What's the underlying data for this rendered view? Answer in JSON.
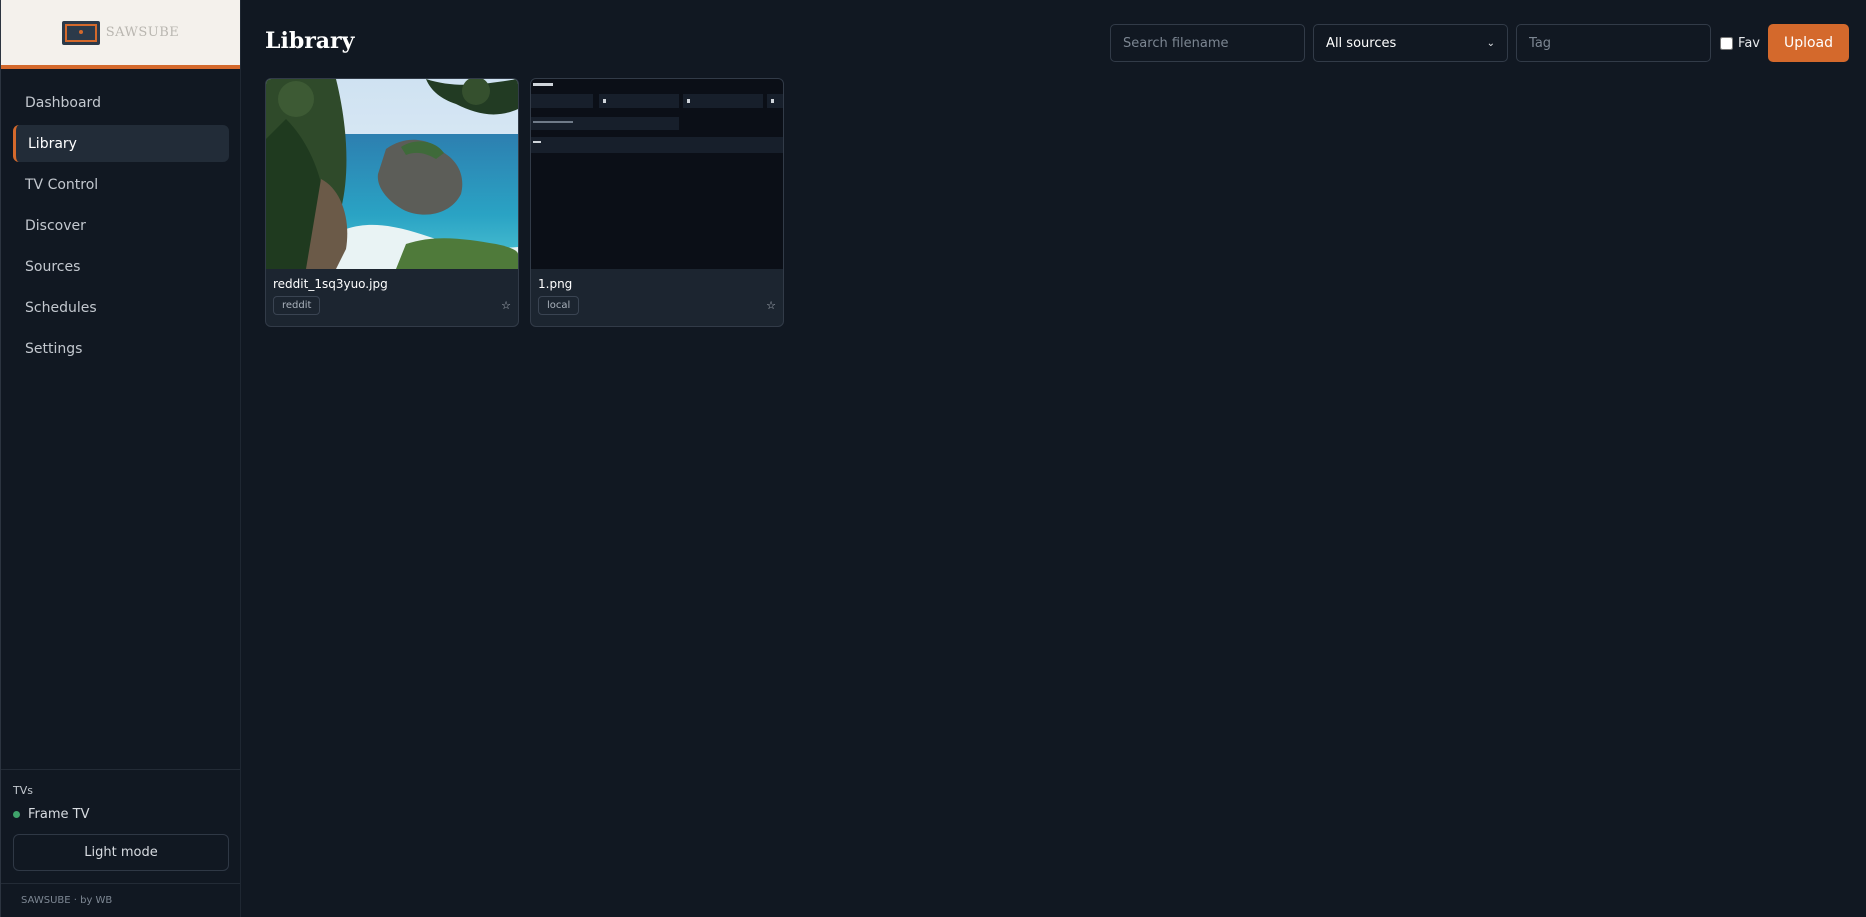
{
  "brand": {
    "name": "SAWSUBE"
  },
  "nav": {
    "items": [
      {
        "label": "Dashboard"
      },
      {
        "label": "Library"
      },
      {
        "label": "TV Control"
      },
      {
        "label": "Discover"
      },
      {
        "label": "Sources"
      },
      {
        "label": "Schedules"
      },
      {
        "label": "Settings"
      }
    ],
    "active": "Library"
  },
  "tvs": {
    "heading": "TVs",
    "items": [
      {
        "name": "Frame TV",
        "status_color": "#3fa36b"
      }
    ]
  },
  "theme_toggle_label": "Light mode",
  "footer_text": "SAWSUBE · by WB",
  "page": {
    "title": "Library"
  },
  "toolbar": {
    "search_placeholder": "Search filename",
    "source_selected": "All sources",
    "tag_placeholder": "Tag",
    "fav_label": "Fav",
    "upload_label": "Upload"
  },
  "cards": [
    {
      "filename": "reddit_1sq3yuo.jpg",
      "source": "reddit",
      "favorite": false,
      "thumbnail": "coastal-landscape-photo"
    },
    {
      "filename": "1.png",
      "source": "local",
      "favorite": false,
      "thumbnail": "dark-ui-screenshot"
    }
  ],
  "colors": {
    "accent": "#d4692c",
    "background": "#111822",
    "card": "#1c2530",
    "status_online": "#3fa36b"
  }
}
